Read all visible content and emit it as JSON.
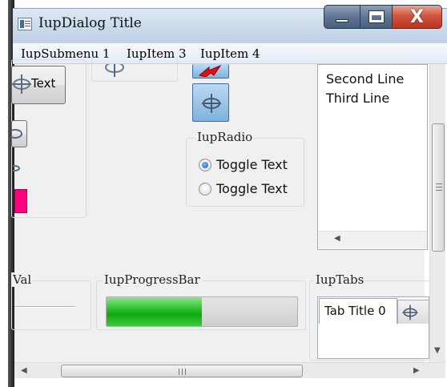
{
  "window": {
    "title": "IupDialog Title",
    "controls": {
      "minimize": "minimize",
      "maximize": "maximize",
      "close": "X"
    }
  },
  "menubar": {
    "items": [
      {
        "label": "IupSubmenu 1"
      },
      {
        "label": "IupItem 3"
      },
      {
        "label": "IupItem 4"
      }
    ]
  },
  "buttons": {
    "text_button_label": "Text"
  },
  "radio_group": {
    "title": "IupRadio",
    "options": [
      {
        "label": "Toggle Text",
        "selected": true
      },
      {
        "label": "Toggle Text",
        "selected": false
      }
    ]
  },
  "multiline": {
    "lines": [
      "Second Line",
      "Third Line"
    ]
  },
  "val_group": {
    "title": "Val"
  },
  "progress_group": {
    "title": "IupProgressBar",
    "value": 0.5
  },
  "tabs_group": {
    "title": "IupTabs",
    "tabs": [
      {
        "label": "Tab Title 0",
        "active": true
      },
      {
        "label": "",
        "active": false
      }
    ]
  },
  "icons": {
    "crosshair": "crosshair-icon",
    "red_arrow": "red-arrow-icon"
  },
  "colors": {
    "progress_fill": "#1fb31f",
    "swatch": "#ff007f",
    "titlebar": "#cddcec",
    "close_button": "#c8452f"
  }
}
